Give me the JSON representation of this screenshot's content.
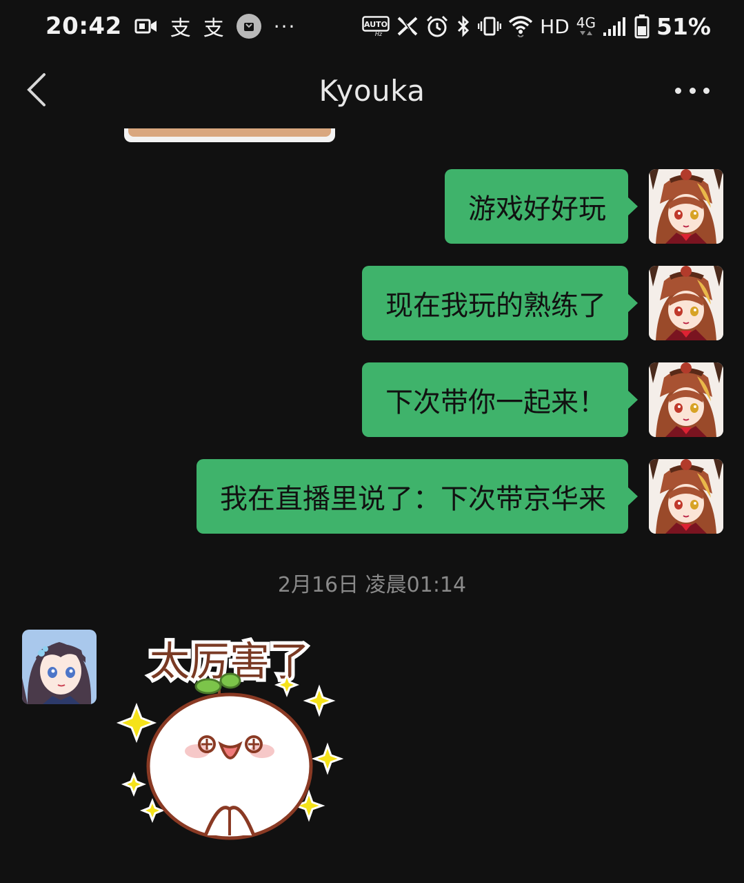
{
  "status_bar": {
    "time": "20:42",
    "left_icons": [
      "video-record-icon",
      "zhihu-icon",
      "zhihu-icon",
      "app-notification-icon",
      "more-dots-icon"
    ],
    "zhi_glyph": "支",
    "more": "···",
    "right_icons": [
      "auto-hz-icon",
      "x-icon",
      "alarm-icon",
      "bluetooth-icon",
      "vibrate-icon",
      "wifi-icon",
      "hd-icon",
      "4g-icon",
      "signal-icon",
      "battery-icon"
    ],
    "hd": "HD",
    "net": "4G",
    "auto_label": "AUTO",
    "hz_label": "Hz",
    "battery": "51%"
  },
  "header": {
    "title": "Kyouka"
  },
  "messages": [
    {
      "side": "right",
      "text": "游戏好好玩"
    },
    {
      "side": "right",
      "text": "现在我玩的熟练了"
    },
    {
      "side": "right",
      "text": "下次带你一起来！"
    },
    {
      "side": "right",
      "text": "我在直播里说了：下次带京华来"
    }
  ],
  "timestamp": "2月16日 凌晨01:14",
  "sticker": {
    "text": "太厉害了"
  },
  "colors": {
    "background": "#111111",
    "bubble_green": "#3fb36b",
    "text_dark": "#111111",
    "timestamp_gray": "#8a8a8a"
  }
}
